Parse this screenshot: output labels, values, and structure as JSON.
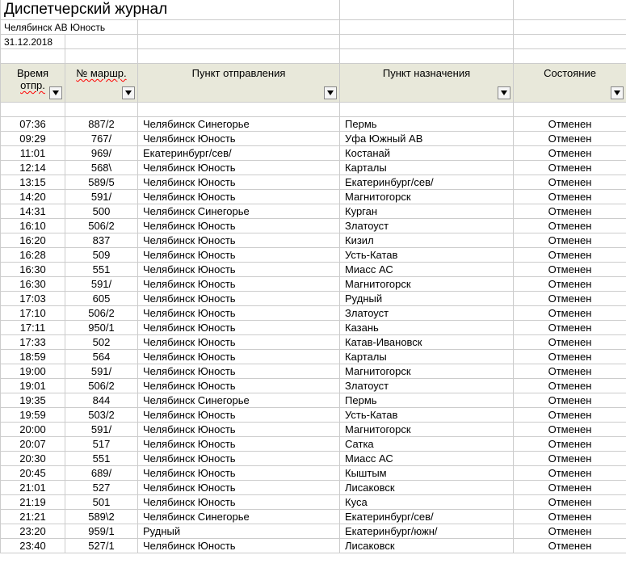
{
  "title": "Диспетчерский журнал",
  "station": "Челябинск АВ Юность",
  "date": "31.12.2018",
  "headers": {
    "time_line1": "Время",
    "time_line2": "отпр.",
    "route": "№ маршр.",
    "departure": "Пункт отправления",
    "destination": "Пункт назначения",
    "status": "Состояние"
  },
  "rows": [
    {
      "time": "07:36",
      "route": "887/2",
      "dep": "Челябинск Синегорье",
      "dest": "Пермь",
      "status": "Отменен"
    },
    {
      "time": "09:29",
      "route": "767/",
      "dep": "Челябинск Юность",
      "dest": "Уфа Южный АВ",
      "status": "Отменен"
    },
    {
      "time": "11:01",
      "route": "969/",
      "dep": "Екатеринбург/сев/",
      "dest": "Костанай",
      "status": "Отменен"
    },
    {
      "time": "12:14",
      "route": "568\\",
      "dep": "Челябинск Юность",
      "dest": "Карталы",
      "status": "Отменен"
    },
    {
      "time": "13:15",
      "route": "589/5",
      "dep": "Челябинск Юность",
      "dest": "Екатеринбург/сев/",
      "status": "Отменен"
    },
    {
      "time": "14:20",
      "route": "591/",
      "dep": "Челябинск Юность",
      "dest": "Магнитогорск",
      "status": "Отменен"
    },
    {
      "time": "14:31",
      "route": "500",
      "dep": "Челябинск Синегорье",
      "dest": "Курган",
      "status": "Отменен"
    },
    {
      "time": "16:10",
      "route": "506/2",
      "dep": "Челябинск Юность",
      "dest": "Златоуст",
      "status": "Отменен"
    },
    {
      "time": "16:20",
      "route": "837",
      "dep": "Челябинск Юность",
      "dest": "Кизил",
      "status": "Отменен"
    },
    {
      "time": "16:28",
      "route": "509",
      "dep": "Челябинск Юность",
      "dest": "Усть-Катав",
      "status": "Отменен"
    },
    {
      "time": "16:30",
      "route": "551",
      "dep": "Челябинск Юность",
      "dest": "Миасс АС",
      "status": "Отменен"
    },
    {
      "time": "16:30",
      "route": "591/",
      "dep": "Челябинск Юность",
      "dest": "Магнитогорск",
      "status": "Отменен"
    },
    {
      "time": "17:03",
      "route": "605",
      "dep": "Челябинск Юность",
      "dest": "Рудный",
      "status": "Отменен"
    },
    {
      "time": "17:10",
      "route": "506/2",
      "dep": "Челябинск Юность",
      "dest": "Златоуст",
      "status": "Отменен"
    },
    {
      "time": "17:11",
      "route": "950/1",
      "dep": "Челябинск Юность",
      "dest": "Казань",
      "status": "Отменен"
    },
    {
      "time": "17:33",
      "route": "502",
      "dep": "Челябинск Юность",
      "dest": "Катав-Ивановск",
      "status": "Отменен"
    },
    {
      "time": "18:59",
      "route": "564",
      "dep": "Челябинск Юность",
      "dest": "Карталы",
      "status": "Отменен"
    },
    {
      "time": "19:00",
      "route": "591/",
      "dep": "Челябинск Юность",
      "dest": "Магнитогорск",
      "status": "Отменен"
    },
    {
      "time": "19:01",
      "route": "506/2",
      "dep": "Челябинск Юность",
      "dest": "Златоуст",
      "status": "Отменен"
    },
    {
      "time": "19:35",
      "route": "844",
      "dep": "Челябинск Синегорье",
      "dest": "Пермь",
      "status": "Отменен"
    },
    {
      "time": "19:59",
      "route": "503/2",
      "dep": "Челябинск Юность",
      "dest": "Усть-Катав",
      "status": "Отменен"
    },
    {
      "time": "20:00",
      "route": "591/",
      "dep": "Челябинск Юность",
      "dest": "Магнитогорск",
      "status": "Отменен"
    },
    {
      "time": "20:07",
      "route": "517",
      "dep": "Челябинск Юность",
      "dest": "Сатка",
      "status": "Отменен"
    },
    {
      "time": "20:30",
      "route": "551",
      "dep": "Челябинск Юность",
      "dest": "Миасс АС",
      "status": "Отменен"
    },
    {
      "time": "20:45",
      "route": "689/",
      "dep": "Челябинск Юность",
      "dest": "Кыштым",
      "status": "Отменен"
    },
    {
      "time": "21:01",
      "route": "527",
      "dep": "Челябинск Юность",
      "dest": "Лисаковск",
      "status": "Отменен"
    },
    {
      "time": "21:19",
      "route": "501",
      "dep": "Челябинск Юность",
      "dest": "Куса",
      "status": "Отменен"
    },
    {
      "time": "21:21",
      "route": "589\\2",
      "dep": "Челябинск Синегорье",
      "dest": "Екатеринбург/сев/",
      "status": "Отменен"
    },
    {
      "time": "23:20",
      "route": "959/1",
      "dep": "Рудный",
      "dest": "Екатеринбург/южн/",
      "status": "Отменен"
    },
    {
      "time": "23:40",
      "route": "527/1",
      "dep": "Челябинск Юность",
      "dest": "Лисаковск",
      "status": "Отменен"
    }
  ]
}
